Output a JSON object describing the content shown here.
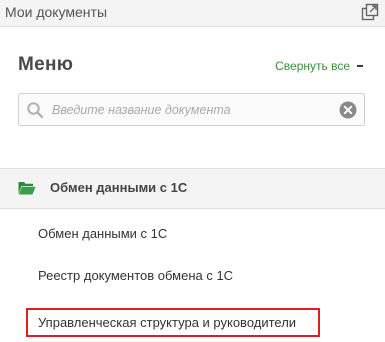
{
  "window": {
    "title": "Мои документы",
    "popout_icon": "popout-icon"
  },
  "menu": {
    "heading": "Меню",
    "collapse_all_label": "Свернуть все"
  },
  "search": {
    "placeholder": "Введите название документа",
    "value": "",
    "search_icon": "search-icon",
    "clear_icon": "clear-icon"
  },
  "section": {
    "label": "Обмен данными с 1С",
    "icon": "folder-open-icon",
    "icon_color": "#2e8b3a",
    "items": [
      {
        "label": "Обмен данными с 1С"
      },
      {
        "label": "Реестр документов обмена с 1С"
      },
      {
        "label": "Управленческая структура и руководители"
      }
    ]
  },
  "colors": {
    "accent_green": "#3a8f3a",
    "highlight_red": "#e02020"
  }
}
